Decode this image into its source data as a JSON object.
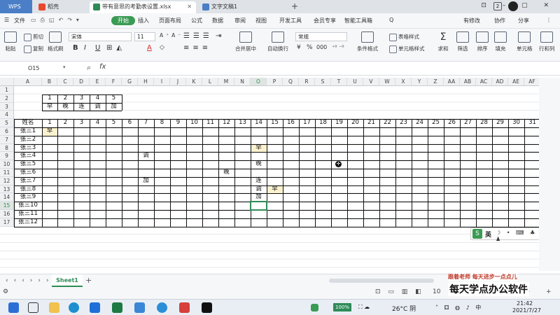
{
  "tabs": {
    "wps": "WPS",
    "items": [
      {
        "label": "稻壳",
        "color": "#e8482f"
      },
      {
        "label": "带有意思的考勤表设置.xlsx",
        "color": "#2e8b57"
      },
      {
        "label": "文字文稿1",
        "color": "#4a7ec6"
      }
    ],
    "badge": "2",
    "window_controls": "⊡ – ▢ ✕"
  },
  "menu": {
    "file": "文件",
    "items": [
      "开始",
      "插入",
      "页面布局",
      "公式",
      "数据",
      "审阅",
      "视图",
      "开发工具",
      "会员专享",
      "智能工具箱"
    ],
    "search": "Q",
    "right": [
      "有修改",
      "协作",
      "分享"
    ]
  },
  "ribbon": {
    "paste": "粘贴",
    "cut": "剪切",
    "copy": "复制",
    "format_painter": "格式刷",
    "font_name": "宋体",
    "font_size": "11",
    "bold": "B",
    "italic": "I",
    "underline": "U",
    "font_color": "A",
    "merge": "合并居中",
    "wrap": "自动换行",
    "number_format": "常规",
    "percent": "%",
    "thousands": "000",
    "conditional": "条件格式",
    "table_style": "表格样式",
    "cell_style": "单元格样式",
    "sum": "求和",
    "filter": "筛选",
    "sort": "排序",
    "fill": "填充",
    "cells": "单元格",
    "rowcol": "行和列"
  },
  "formula": {
    "name_box": "O15",
    "fx": "fx",
    "zoom": "🔍"
  },
  "sheet": {
    "columns": [
      "A",
      "B",
      "C",
      "D",
      "E",
      "F",
      "G",
      "H",
      "I",
      "J",
      "K",
      "L",
      "M",
      "N",
      "O",
      "P",
      "Q",
      "R",
      "S",
      "T",
      "U",
      "V",
      "W",
      "X",
      "Y",
      "Z",
      "AA",
      "AB",
      "AC",
      "AD",
      "AE",
      "AF"
    ],
    "rows": [
      "1",
      "2",
      "3",
      "4",
      "5",
      "6",
      "7",
      "8",
      "9",
      "10",
      "11",
      "12",
      "13",
      "14",
      "15",
      "16",
      "17"
    ],
    "legend_numbers": [
      "1",
      "2",
      "3",
      "4",
      "5"
    ],
    "legend_labels": [
      "早",
      "晚",
      "连",
      "调",
      "加"
    ],
    "header_name": "姓名",
    "days": [
      "1",
      "2",
      "3",
      "4",
      "5",
      "6",
      "7",
      "8",
      "9",
      "10",
      "11",
      "12",
      "13",
      "14",
      "15",
      "16",
      "17",
      "18",
      "19",
      "20",
      "21",
      "22",
      "23",
      "24",
      "25",
      "26",
      "27",
      "28",
      "29",
      "30",
      "31"
    ],
    "employees": [
      "张三1",
      "张三2",
      "张三3",
      "张三4",
      "张三5",
      "张三6",
      "张三7",
      "张三8",
      "张三9",
      "张三10",
      "张三11",
      "张三12"
    ],
    "marks": [
      {
        "emp": 0,
        "day": 1,
        "text": "早",
        "highlight": true
      },
      {
        "emp": 2,
        "day": 14,
        "text": "早",
        "highlight": true
      },
      {
        "emp": 3,
        "day": 7,
        "text": "调",
        "highlight": false
      },
      {
        "emp": 4,
        "day": 14,
        "text": "晚",
        "highlight": false
      },
      {
        "emp": 5,
        "day": 12,
        "text": "晚",
        "highlight": false
      },
      {
        "emp": 6,
        "day": 7,
        "text": "加",
        "highlight": false
      },
      {
        "emp": 6,
        "day": 14,
        "text": "连",
        "highlight": false
      },
      {
        "emp": 7,
        "day": 14,
        "text": "调",
        "highlight": false
      },
      {
        "emp": 7,
        "day": 15,
        "text": "早",
        "highlight": true
      },
      {
        "emp": 8,
        "day": 14,
        "text": "加",
        "highlight": false
      }
    ],
    "sheet_tab": "Sheet1",
    "add_sheet": "+"
  },
  "ime": {
    "logo": "S",
    "lang": "英",
    "icons": "☽ • ⌨ ♣ ♟"
  },
  "status": {
    "view_icons": "⊡ ▭ ▥ ◧",
    "zoom_value": "10",
    "zoom_minus": "−",
    "zoom_plus": "+"
  },
  "watermark": {
    "line1": "跟着老师  每天进步一点点儿",
    "line2": "每天学点办公软件"
  },
  "taskbar": {
    "battery": "100%",
    "weather": "26°C 阴",
    "time": "21:42",
    "date": "2021/7/27"
  },
  "colors": {
    "accent": "#2e8b57",
    "highlight": "#fdf2cf"
  }
}
